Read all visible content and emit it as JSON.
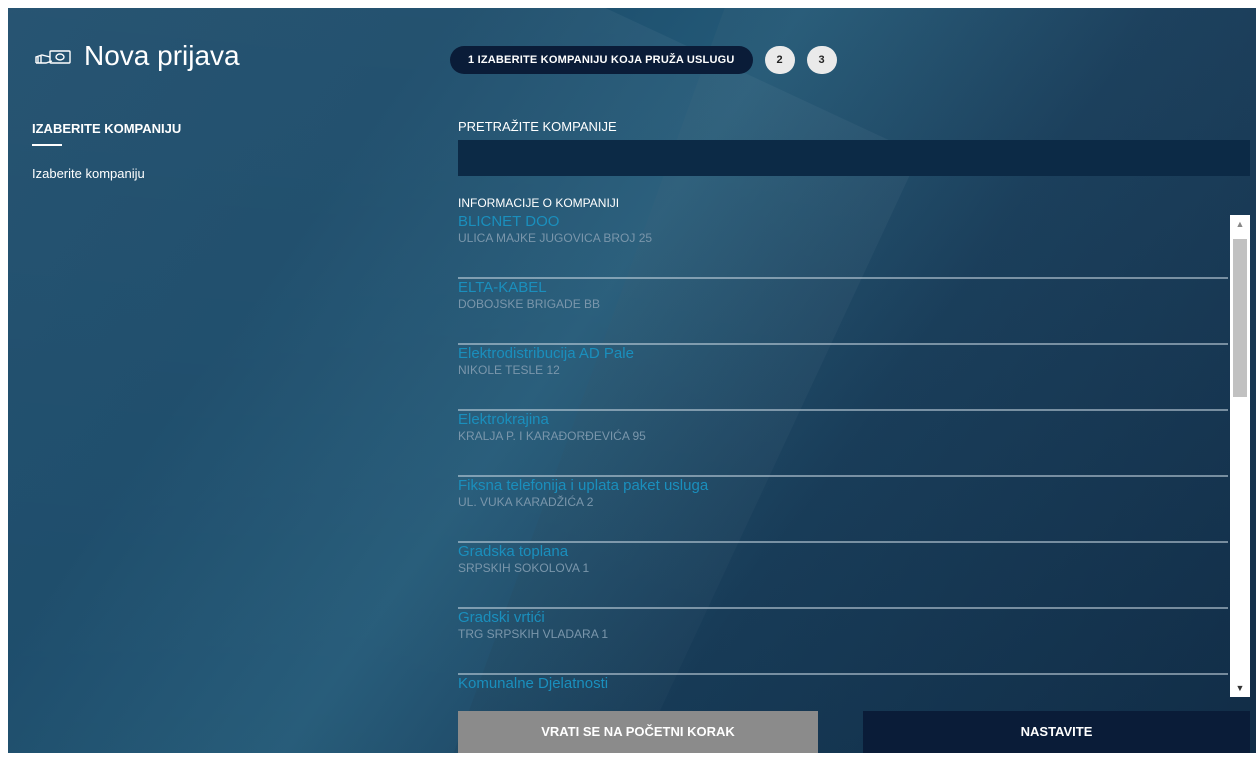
{
  "header": {
    "title": "Nova prijava",
    "title_icon": "hand-holding-card-icon",
    "steps": {
      "active_label": "1 IZABERITE KOMPANIJU KOJA PRUŽA USLUGU",
      "step2": "2",
      "step3": "3"
    }
  },
  "sidebar": {
    "heading": "IZABERITE KOMPANIJU",
    "item": "Izaberite kompaniju"
  },
  "search": {
    "label": "PRETRAŽITE KOMPANIJE",
    "value": "",
    "placeholder": ""
  },
  "info": {
    "label": "INFORMACIJE O KOMPANIJI"
  },
  "companies": [
    {
      "name": "BLICNET DOO",
      "address": "ULICA MAJKE JUGOVICA BROJ 25"
    },
    {
      "name": "ELTA-KABEL",
      "address": "DOBOJSKE BRIGADE BB"
    },
    {
      "name": "Elektrodistribucija AD Pale",
      "address": "NIKOLE TESLE 12"
    },
    {
      "name": "Elektrokrajina",
      "address": "KRALJA P. I KARAĐORĐEVIĆA 95"
    },
    {
      "name": "Fiksna telefonija i uplata paket usluga",
      "address": "UL. VUKA KARADŽIĆA 2"
    },
    {
      "name": "Gradska toplana",
      "address": "SRPSKIH SOKOLOVA 1"
    },
    {
      "name": "Gradski vrtići",
      "address": "TRG SRPSKIH VLADARA 1"
    },
    {
      "name": "Komunalne Djelatnosti",
      "address": ""
    }
  ],
  "buttons": {
    "back": "VRATI SE NA POČETNI KORAK",
    "next": "NASTAVITE"
  },
  "colors": {
    "background": "#1e4d6c",
    "accent_dark": "#0a1c38",
    "company_name": "#1a8fbd",
    "back_button": "#8b8b8b"
  }
}
